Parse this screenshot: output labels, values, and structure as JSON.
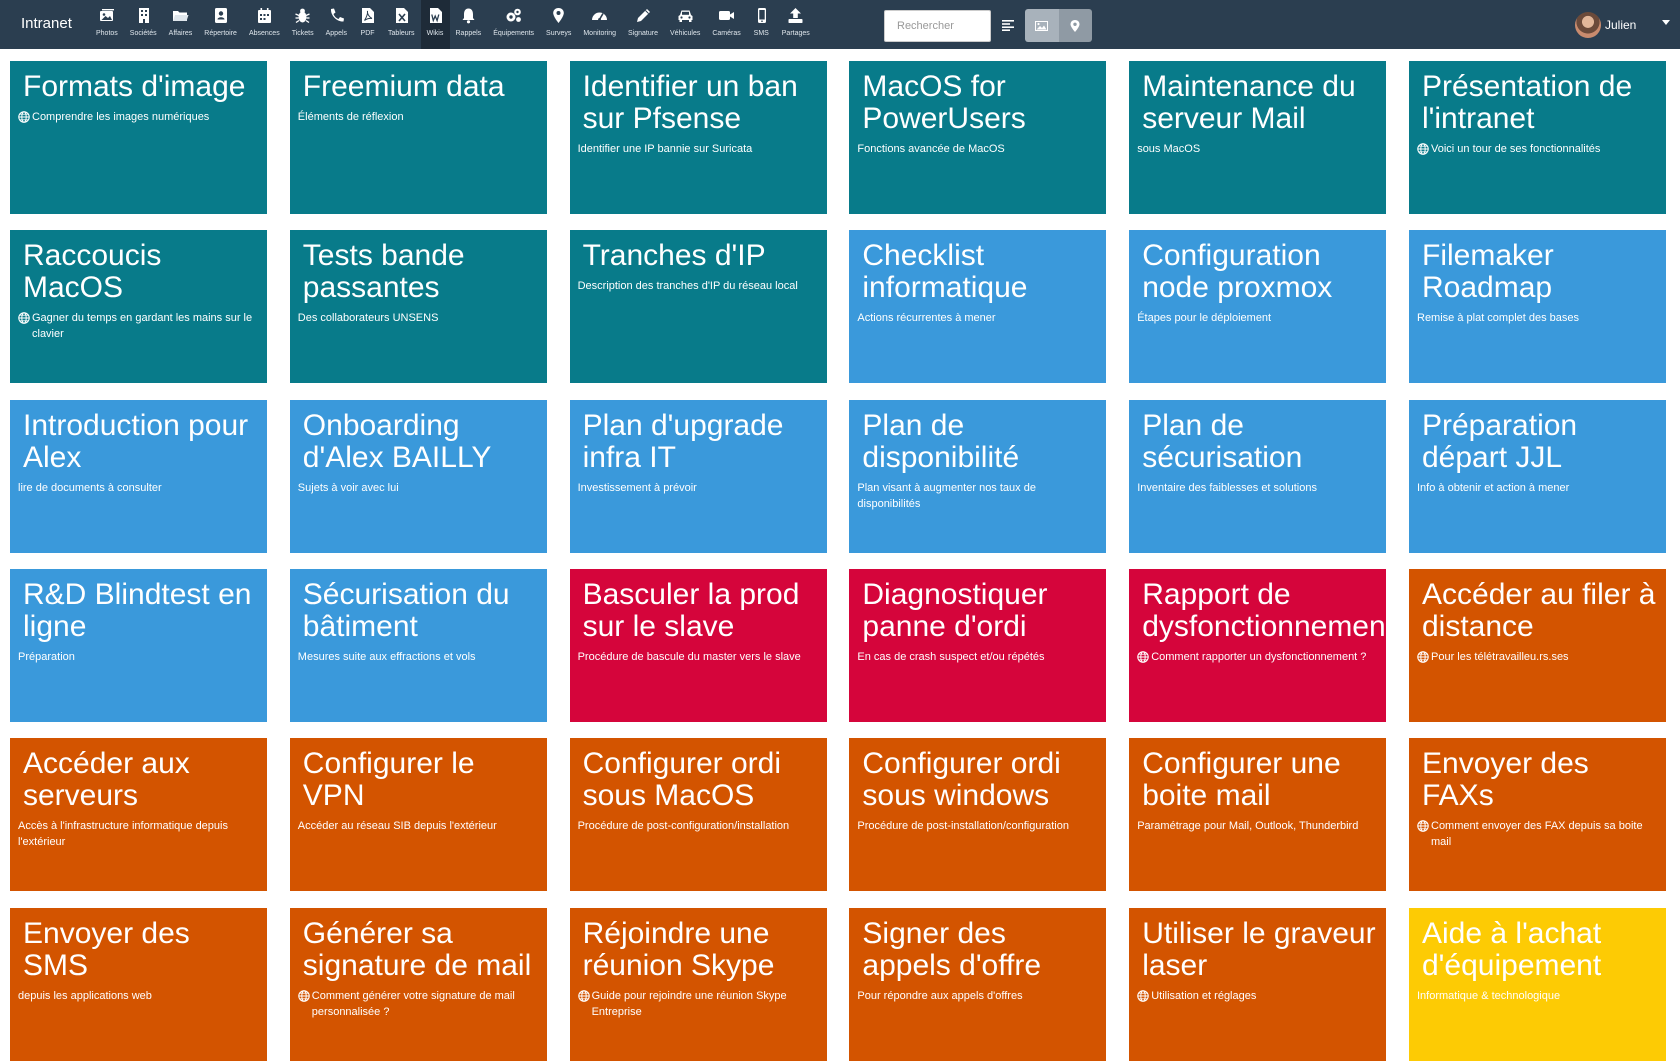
{
  "app": {
    "brand": "Intranet"
  },
  "nav": [
    {
      "label": "Photos",
      "icon": "photos-icon"
    },
    {
      "label": "Sociétés",
      "icon": "building-icon"
    },
    {
      "label": "Affaires",
      "icon": "folder-icon"
    },
    {
      "label": "Répertoire",
      "icon": "contact-book-icon"
    },
    {
      "label": "Absences",
      "icon": "calendar-icon"
    },
    {
      "label": "Tickets",
      "icon": "bug-icon"
    },
    {
      "label": "Appels",
      "icon": "phone-icon"
    },
    {
      "label": "PDF",
      "icon": "pdf-icon"
    },
    {
      "label": "Tableurs",
      "icon": "spreadsheet-icon"
    },
    {
      "label": "Wikis",
      "icon": "wiki-icon",
      "active": true
    },
    {
      "label": "Rappels",
      "icon": "bell-icon"
    },
    {
      "label": "Équipements",
      "icon": "gears-icon"
    },
    {
      "label": "Surveys",
      "icon": "map-marker-icon"
    },
    {
      "label": "Monitoring",
      "icon": "dashboard-icon"
    },
    {
      "label": "Signature",
      "icon": "pencil-icon"
    },
    {
      "label": "Véhicules",
      "icon": "car-icon"
    },
    {
      "label": "Caméras",
      "icon": "video-camera-icon"
    },
    {
      "label": "SMS",
      "icon": "mobile-icon"
    },
    {
      "label": "Partages",
      "icon": "upload-icon"
    }
  ],
  "search": {
    "placeholder": "Rechercher",
    "value": ""
  },
  "view_buttons": [
    {
      "icon": "image-icon",
      "active": true
    },
    {
      "icon": "map-marker-icon",
      "active": false
    }
  ],
  "user": {
    "name": "Julien"
  },
  "colors": {
    "teal": "#087b8a",
    "blue": "#3a99db",
    "red": "#d5053b",
    "orange": "#d35400",
    "yellow": "#fdcb04",
    "navbar": "#2b3e50"
  },
  "tiles": [
    {
      "title": "Formats d'image",
      "subtitle": "Comprendre les images numériques",
      "color": "teal",
      "globe": true
    },
    {
      "title": "Freemium data",
      "subtitle": "Éléments de réflexion",
      "color": "teal",
      "globe": false
    },
    {
      "title": "Identifier un ban sur Pfsense",
      "subtitle": "Identifier une IP bannie sur Suricata",
      "color": "teal",
      "globe": false
    },
    {
      "title": "MacOS for PowerUsers",
      "subtitle": "Fonctions avancée de MacOS",
      "color": "teal",
      "globe": false
    },
    {
      "title": "Maintenance du serveur Mail",
      "subtitle": "sous MacOS",
      "color": "teal",
      "globe": false
    },
    {
      "title": "Présentation de l'intranet",
      "subtitle": "Voici un tour de ses fonctionnalités",
      "color": "teal",
      "globe": true
    },
    {
      "title": "Raccoucis MacOS",
      "subtitle": "Gagner du temps en gardant les mains sur le clavier",
      "color": "teal",
      "globe": true
    },
    {
      "title": "Tests bande passantes",
      "subtitle": "Des collaborateurs UNSENS",
      "color": "teal",
      "globe": false
    },
    {
      "title": "Tranches d'IP",
      "subtitle": "Description des tranches d'IP du réseau local",
      "color": "teal",
      "globe": false
    },
    {
      "title": "Checklist informatique",
      "subtitle": "Actions récurrentes à mener",
      "color": "blue",
      "globe": false
    },
    {
      "title": "Configuration node proxmox",
      "subtitle": "Étapes pour le déploiement",
      "color": "blue",
      "globe": false
    },
    {
      "title": "Filemaker Roadmap",
      "subtitle": "Remise à plat complet des bases",
      "color": "blue",
      "globe": false
    },
    {
      "title": "Introduction pour Alex",
      "subtitle": "lire de documents à consulter",
      "color": "blue",
      "globe": false
    },
    {
      "title": "Onboarding d'Alex BAILLY",
      "subtitle": "Sujets à voir avec lui",
      "color": "blue",
      "globe": false
    },
    {
      "title": "Plan d'upgrade infra IT",
      "subtitle": "Investissement à prévoir",
      "color": "blue",
      "globe": false
    },
    {
      "title": "Plan de disponibilité",
      "subtitle": "Plan visant à augmenter nos taux de disponibilités",
      "color": "blue",
      "globe": false
    },
    {
      "title": "Plan de sécurisation",
      "subtitle": "Inventaire des faiblesses et solutions",
      "color": "blue",
      "globe": false
    },
    {
      "title": "Préparation départ JJL",
      "subtitle": "Info à obtenir et action à mener",
      "color": "blue",
      "globe": false
    },
    {
      "title": "R&D Blindtest en ligne",
      "subtitle": "Préparation",
      "color": "blue",
      "globe": false
    },
    {
      "title": "Sécurisation du bâtiment",
      "subtitle": "Mesures suite aux effractions et vols",
      "color": "blue",
      "globe": false
    },
    {
      "title": "Basculer la prod sur le slave",
      "subtitle": "Procédure de bascule du master vers le slave",
      "color": "red",
      "globe": false
    },
    {
      "title": "Diagnostiquer panne d'ordi",
      "subtitle": "En cas de crash suspect et/ou répétés",
      "color": "red",
      "globe": false
    },
    {
      "title": "Rapport de dysfonctionnement",
      "subtitle": "Comment rapporter un dysfonctionnement ?",
      "color": "red",
      "globe": true
    },
    {
      "title": "Accéder au filer à distance",
      "subtitle": "Pour les télétravailleu.rs.ses",
      "color": "orange",
      "globe": true
    },
    {
      "title": "Accéder aux serveurs",
      "subtitle": "Accès à l'infrastructure informatique depuis l'extérieur",
      "color": "orange",
      "globe": false
    },
    {
      "title": "Configurer le VPN",
      "subtitle": "Accéder au réseau SIB depuis l'extérieur",
      "color": "orange",
      "globe": false
    },
    {
      "title": "Configurer ordi sous MacOS",
      "subtitle": "Procédure de post-configuration/installation",
      "color": "orange",
      "globe": false
    },
    {
      "title": "Configurer ordi sous windows",
      "subtitle": "Procédure de post-installation/configuration",
      "color": "orange",
      "globe": false
    },
    {
      "title": "Configurer une boite mail",
      "subtitle": "Paramétrage pour Mail, Outlook, Thunderbird",
      "color": "orange",
      "globe": false
    },
    {
      "title": "Envoyer des FAXs",
      "subtitle": "Comment envoyer des FAX depuis sa boite mail",
      "color": "orange",
      "globe": true
    },
    {
      "title": "Envoyer des SMS",
      "subtitle": "depuis les applications web",
      "color": "orange",
      "globe": false
    },
    {
      "title": "Générer sa signature de mail",
      "subtitle": "Comment générer votre signature de mail personnalisée ?",
      "color": "orange",
      "globe": true
    },
    {
      "title": "Réjoindre une réunion Skype",
      "subtitle": "Guide pour rejoindre une réunion Skype Entreprise",
      "color": "orange",
      "globe": true
    },
    {
      "title": "Signer des appels d'offre",
      "subtitle": "Pour répondre aux appels d'offres",
      "color": "orange",
      "globe": false
    },
    {
      "title": "Utiliser le graveur laser",
      "subtitle": "Utilisation et réglages",
      "color": "orange",
      "globe": true
    },
    {
      "title": "Aide à l'achat d'équipement",
      "subtitle": "Informatique & technologique",
      "color": "yellow",
      "globe": false
    }
  ]
}
